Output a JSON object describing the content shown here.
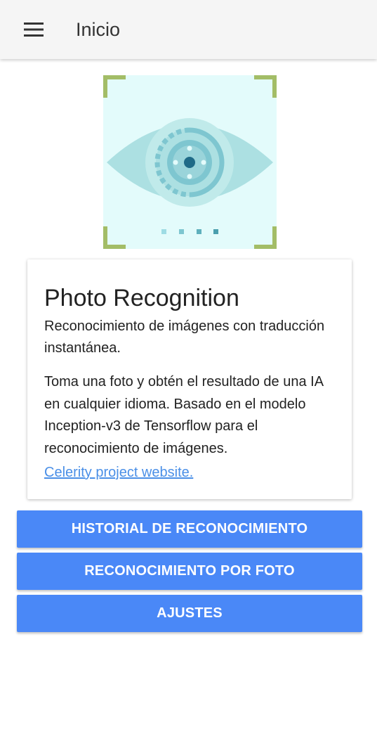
{
  "header": {
    "title": "Inicio",
    "menu_icon": "menu-icon"
  },
  "hero": {
    "icon": "eye-scan-icon",
    "colors": {
      "background": "#e3fbfb",
      "corners": "#a3bd67",
      "eye": "#ace0e2",
      "iris": "#7ec6d0",
      "pupil": "#1f6a87"
    }
  },
  "card": {
    "title": "Photo Recognition",
    "subtitle": "Reconocimiento de imágenes con traducción instantánea.",
    "body": "Toma una foto y obtén el resultado de una IA en cualquier idioma. Basado en el modelo Inception-v3 de Tensorflow para el reconocimiento de imágenes.",
    "link": "Celerity project website."
  },
  "buttons": [
    {
      "label": "HISTORIAL DE RECONOCIMIENTO"
    },
    {
      "label": "RECONOCIMIENTO POR FOTO"
    },
    {
      "label": "AJUSTES"
    }
  ],
  "colors": {
    "primary": "#4a88f7",
    "link": "#4a8fe7",
    "topbar": "#f5f5f5"
  }
}
